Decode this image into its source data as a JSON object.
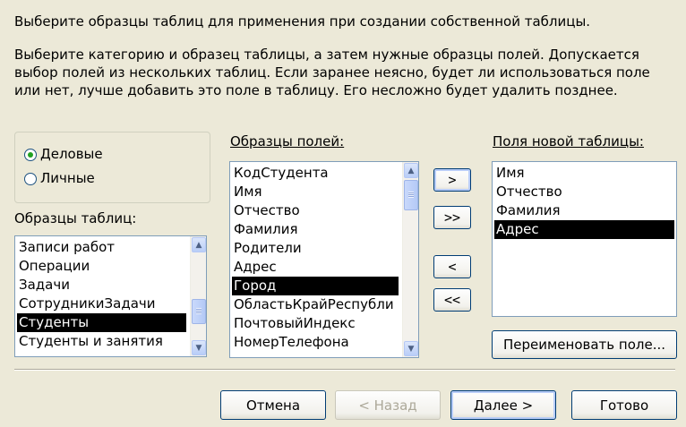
{
  "intro": {
    "line1": "Выберите образцы таблиц для применения при создании собственной таблицы.",
    "line2": "Выберите категорию и образец таблицы, а затем нужные образцы полей. Допускается",
    "line3": "выбор полей из нескольких таблиц. Если заранее неясно, будет ли использоваться поле",
    "line4": "или нет, лучше добавить это поле в таблицу. Его несложно будет удалить позднее."
  },
  "category": {
    "business_label": "Деловые",
    "personal_label": "Личные",
    "selected": "business"
  },
  "sample_tables": {
    "label": "Образцы таблиц:",
    "items": [
      "Записи работ",
      "Операции",
      "Задачи",
      "СотрудникиЗадачи",
      "Студенты",
      "Студенты и занятия"
    ],
    "selected_index": 4
  },
  "sample_fields": {
    "label": "Образцы полей:",
    "items": [
      "КодСтудента",
      "Имя",
      "Отчество",
      "Фамилия",
      "Родители",
      "Адрес",
      "Город",
      "ОбластьКрайРеспубли",
      "ПочтовыйИндекс",
      "НомерТелефона"
    ],
    "selected_index": 6
  },
  "new_fields": {
    "label": "Поля новой таблицы:",
    "items": [
      "Имя",
      "Отчество",
      "Фамилия",
      "Адрес"
    ],
    "selected_index": 3
  },
  "move_buttons": {
    "add_one": ">",
    "add_all": ">>",
    "remove_one": "<",
    "remove_all": "<<"
  },
  "rename_button": "Переименовать поле...",
  "footer": {
    "cancel": "Отмена",
    "back": "< Назад",
    "next": "Далее >",
    "finish": "Готово"
  },
  "colors": {
    "dialog_bg": "#ece9d8",
    "selection_bg": "#000000",
    "button_border": "#003c74"
  }
}
